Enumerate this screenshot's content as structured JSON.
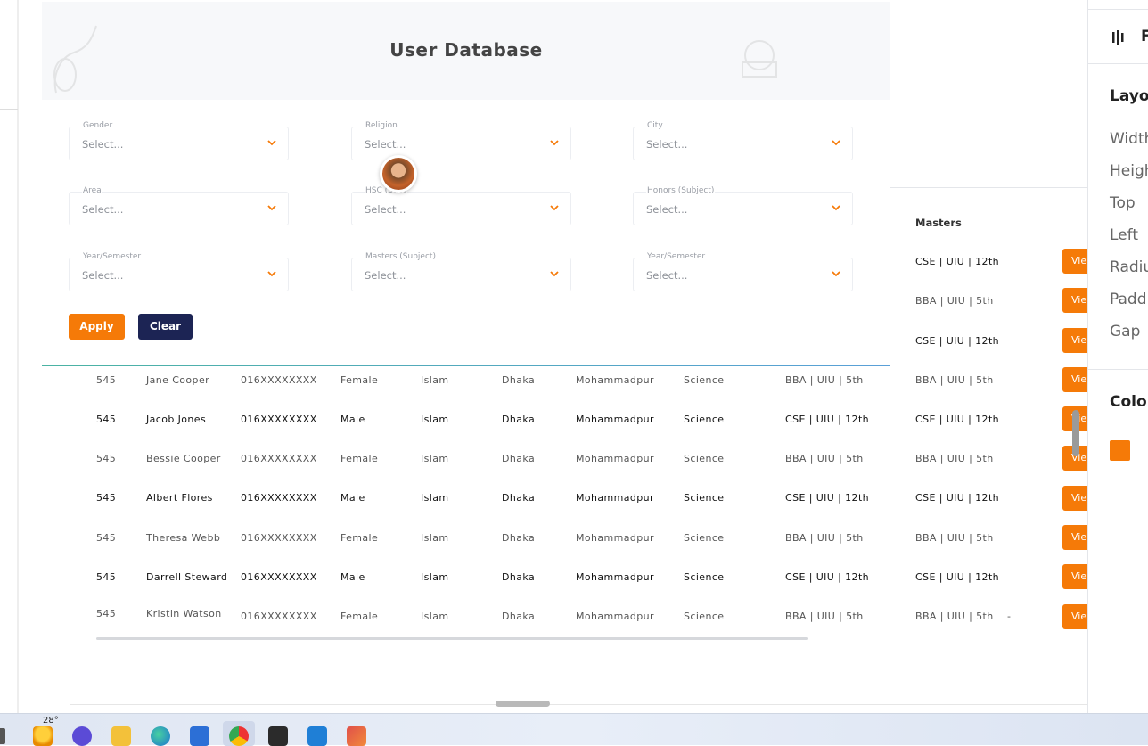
{
  "page_title": "User Database",
  "filters": [
    {
      "label": "Gender",
      "placeholder": "Select..."
    },
    {
      "label": "Religion",
      "placeholder": "Select..."
    },
    {
      "label": "City",
      "placeholder": "Select..."
    },
    {
      "label": "Area",
      "placeholder": "Select..."
    },
    {
      "label": "HSC (Sub)",
      "placeholder": "Select..."
    },
    {
      "label": "Honors (Subject)",
      "placeholder": "Select..."
    },
    {
      "label": "Year/Semester",
      "placeholder": "Select..."
    },
    {
      "label": "Masters (Subject)",
      "placeholder": "Select..."
    },
    {
      "label": "Year/Semester",
      "placeholder": "Select..."
    }
  ],
  "buttons": {
    "apply": "Apply",
    "clear": "Clear"
  },
  "table": {
    "masters_header": "Masters",
    "view_label": "Vie",
    "dash": "-",
    "upper_masters": [
      "CSE | UIU | 12th",
      "BBA | UIU | 5th",
      "CSE | UIU | 12th",
      "BBA | UIU | 5th"
    ],
    "rows": [
      {
        "id": "545",
        "name": "Jane Cooper",
        "phone": "016XXXXXXXX",
        "gender": "Female",
        "religion": "Islam",
        "city": "Dhaka",
        "area": "Mohammadpur",
        "hsc": "Science",
        "honors": "BBA | UIU | 5th",
        "masters": "BBA | UIU | 5th"
      },
      {
        "id": "545",
        "name": "Jacob Jones",
        "phone": "016XXXXXXXX",
        "gender": "Male",
        "religion": "Islam",
        "city": "Dhaka",
        "area": "Mohammadpur",
        "hsc": "Science",
        "honors": "CSE | UIU | 12th",
        "masters": "CSE | UIU | 12th"
      },
      {
        "id": "545",
        "name": "Bessie Cooper",
        "phone": "016XXXXXXXX",
        "gender": "Female",
        "religion": "Islam",
        "city": "Dhaka",
        "area": "Mohammadpur",
        "hsc": "Science",
        "honors": "BBA | UIU | 5th",
        "masters": "BBA | UIU | 5th"
      },
      {
        "id": "545",
        "name": "Albert Flores",
        "phone": "016XXXXXXXX",
        "gender": "Male",
        "religion": "Islam",
        "city": "Dhaka",
        "area": "Mohammadpur",
        "hsc": "Science",
        "honors": "CSE | UIU | 12th",
        "masters": "CSE | UIU | 12th"
      },
      {
        "id": "545",
        "name": "Theresa Webb",
        "phone": "016XXXXXXXX",
        "gender": "Female",
        "religion": "Islam",
        "city": "Dhaka",
        "area": "Mohammadpur",
        "hsc": "Science",
        "honors": "BBA | UIU | 5th",
        "masters": "BBA | UIU | 5th"
      },
      {
        "id": "545",
        "name": "Darrell Steward",
        "phone": "016XXXXXXXX",
        "gender": "Male",
        "religion": "Islam",
        "city": "Dhaka",
        "area": "Mohammadpur",
        "hsc": "Science",
        "honors": "CSE | UIU | 12th",
        "masters": "CSE | UIU | 12th"
      },
      {
        "id": "545",
        "name": "Kristin Watson",
        "phone": "016XXXXXXXX",
        "gender": "Female",
        "religion": "Islam",
        "city": "Dhaka",
        "area": "Mohammadpur",
        "hsc": "Science",
        "honors": "BBA | UIU | 5th",
        "masters": "BBA | UIU | 5th"
      }
    ]
  },
  "properties_panel": {
    "header_letter": "F",
    "layout_title": "Layou",
    "items": [
      "Width",
      "Heigh",
      "Top",
      "Left",
      "Radiu",
      "Paddi",
      "Gap"
    ],
    "color_title": "Color",
    "swatch_color": "#f57a08"
  },
  "taskbar": {
    "weather_temp": "28°"
  },
  "colors": {
    "accent": "#f57a08",
    "clear_button": "#1c2454"
  }
}
